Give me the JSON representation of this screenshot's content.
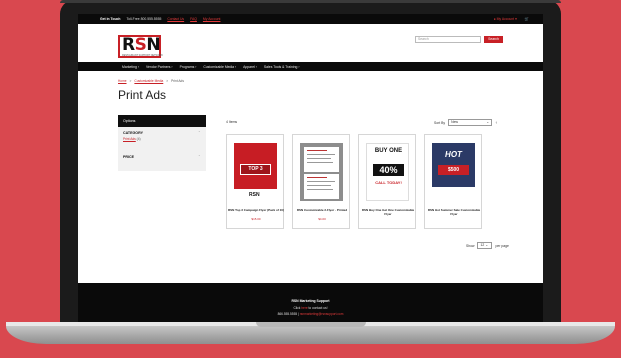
{
  "topbar": {
    "get_in_touch": "Get in Touch",
    "toll_free": "Toll-Free 800.555.5555",
    "contact_us": "Contact Us",
    "faq": "FAQ",
    "my_account": "My Account",
    "account_menu": "My Account",
    "cart_icon": "cart-icon"
  },
  "header": {
    "logo": "RSN",
    "logo_tagline": "RESTAURANT SUPPORT NETWORK",
    "search_placeholder": "Search",
    "search_button": "Search"
  },
  "nav": {
    "items": [
      "Marketing",
      "Vendor Partners",
      "Programs",
      "Customizable Media",
      "Apparel",
      "Sales Tools & Training"
    ]
  },
  "breadcrumb": [
    "Home",
    "Customizable Media",
    "Print Ads"
  ],
  "page_title": "Print Ads",
  "sidebar": {
    "heading": "Options",
    "category_label": "CATEGORY",
    "category_item": "Print Ads",
    "category_count": "(4)",
    "price_label": "PRICE"
  },
  "toolbar": {
    "items_count": "4 Items",
    "sort_label": "Sort By",
    "sort_value": "New"
  },
  "products": [
    {
      "name": "RSN Top 3 Campaign Flyer (Pack of 10)",
      "price": "$15.00",
      "thumb_text": "TOP 3"
    },
    {
      "name": "RSN Customizable 2-Flyer - Printed",
      "price": "$4.00",
      "thumb_text": ""
    },
    {
      "name": "RSN Buy One Get One Customizable Flyer",
      "price": "",
      "thumb_text": "BUY ONE"
    },
    {
      "name": "RSN Hot Summer Sale Customizable Flyer",
      "price": "",
      "thumb_text": "HOT"
    }
  ],
  "pager": {
    "show_label": "Show",
    "per_page_value": "12",
    "per_page_label": "per page"
  },
  "footer": {
    "title": "RSN Marketing Support",
    "click_prefix": "Click",
    "click_link": "here",
    "click_suffix": "to contact us!",
    "phone": "866.555.5555 |",
    "email": "rsnmarketing@rsnsupport.com"
  },
  "colors": {
    "brand_red": "#c82026",
    "background": "#d9484f"
  }
}
